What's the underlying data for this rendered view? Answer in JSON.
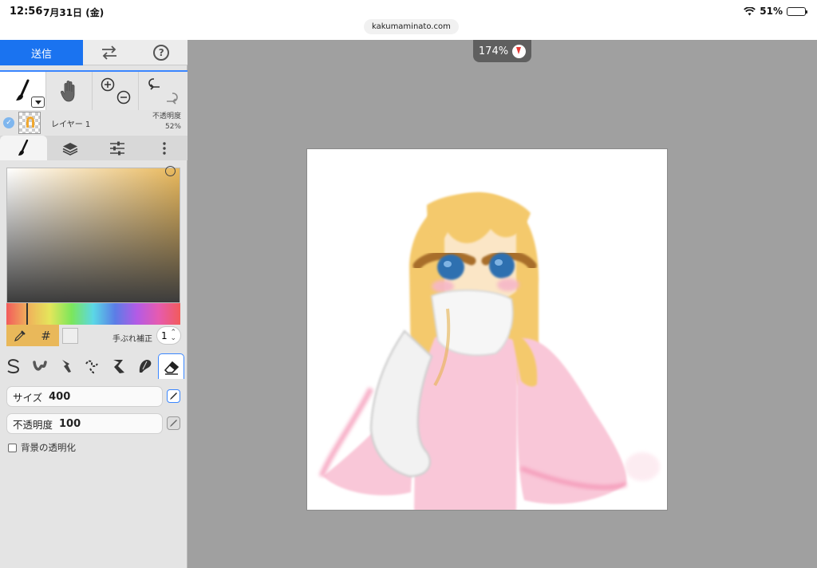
{
  "status_bar": {
    "time": "12:56",
    "date": "7月31日 (金)",
    "battery": "51%",
    "battery_level": 0.51,
    "url": "kakumaminato.com"
  },
  "toolbar": {
    "send_label": "送信",
    "swap_icon": "swap-arrows-icon",
    "help_icon": "help-icon"
  },
  "tools": {
    "brush_tool": "brush-icon",
    "hand_tool": "hand-icon",
    "zoom_in": "zoom-in-icon",
    "zoom_out": "zoom-out-icon",
    "undo": "undo-icon",
    "redo": "redo-icon"
  },
  "layer": {
    "name": "レイヤー 1",
    "opacity_label": "不透明度",
    "opacity_value": "52%"
  },
  "tabs": [
    "brush",
    "layers",
    "adjustments",
    "more"
  ],
  "color": {
    "current": "#e9b85a",
    "hash_label": "#",
    "stabilizer_label": "手ぶれ補正",
    "stabilizer_value": "1"
  },
  "brushes": [
    "pen",
    "watercolor",
    "smudge",
    "curve",
    "ribbon",
    "blur",
    "eraser"
  ],
  "active_brush": "eraser",
  "settings": {
    "size_label": "サイズ",
    "size_value": "400",
    "opacity_label": "不透明度",
    "opacity_value": "100",
    "bg_transparent_label": "背景の透明化"
  },
  "canvas": {
    "zoom": "174%"
  },
  "colors": {
    "accent": "#1a73f0",
    "panel": "#e4e4e4",
    "workspace": "#a0a0a0"
  }
}
